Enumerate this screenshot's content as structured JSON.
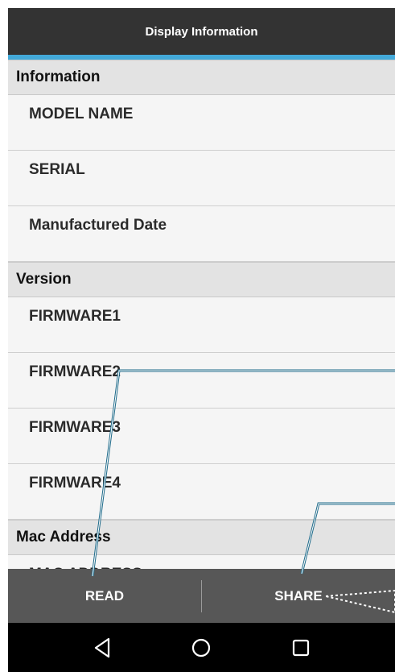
{
  "appbar": {
    "title": "Display Information"
  },
  "sections": [
    {
      "header": "Information",
      "rows": [
        "MODEL NAME",
        "SERIAL",
        "Manufactured Date"
      ]
    },
    {
      "header": "Version",
      "rows": [
        "FIRMWARE1",
        "FIRMWARE2",
        "FIRMWARE3",
        "FIRMWARE4"
      ]
    },
    {
      "header": "Mac Address",
      "rows": [
        "MAC ADDRESS"
      ]
    }
  ],
  "actions": {
    "read": "READ",
    "share": "SHARE"
  },
  "navbar": {
    "icons": [
      "back-icon",
      "home-icon",
      "recents-icon"
    ]
  },
  "colors": {
    "appbar": "#333333",
    "accent": "#43a9d9",
    "actionbar": "#575757",
    "callout": "#1f6b8a"
  }
}
